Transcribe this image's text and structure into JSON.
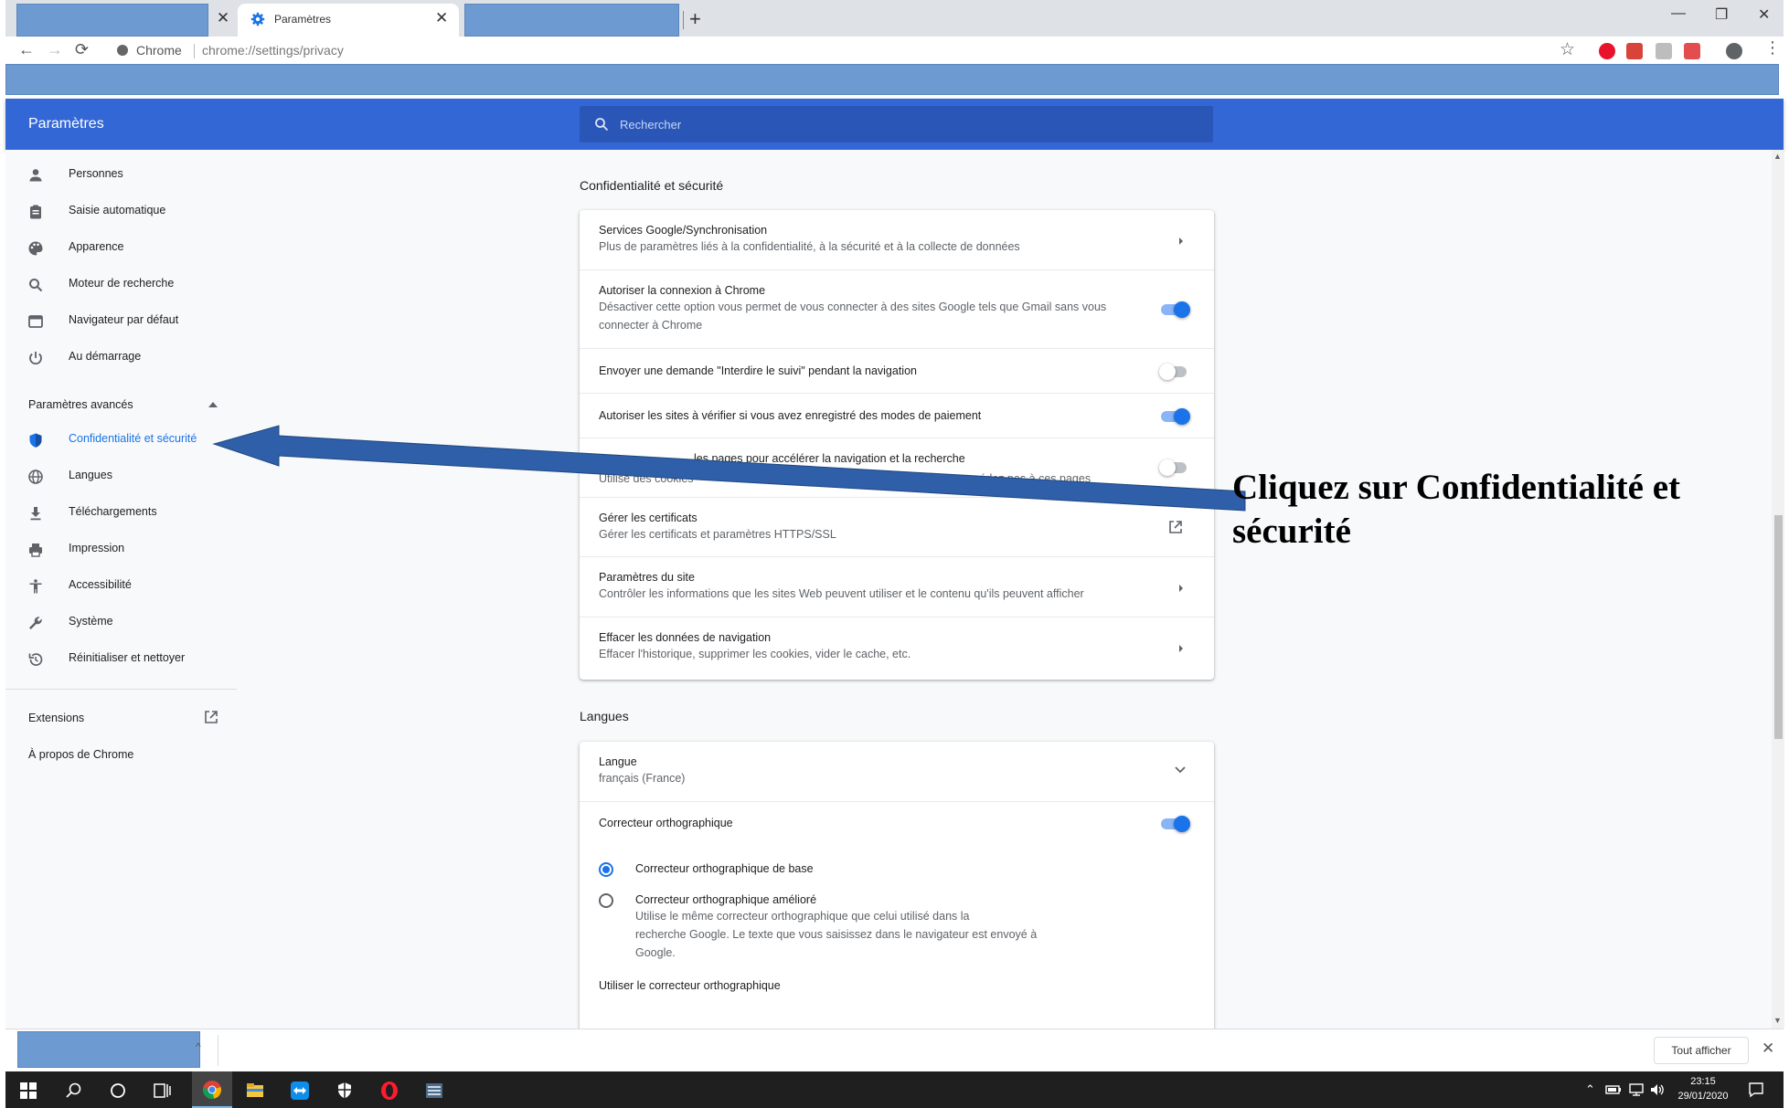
{
  "browser": {
    "active_tab_title": "Paramètres",
    "omnibox_site": "Chrome",
    "omnibox_url": "chrome://settings/privacy",
    "accent_color": "#3367d6"
  },
  "header": {
    "title": "Paramètres",
    "search_placeholder": "Rechercher"
  },
  "sidebar": {
    "items": [
      {
        "label": "Personnes",
        "icon": "person-icon"
      },
      {
        "label": "Saisie automatique",
        "icon": "clipboard-icon"
      },
      {
        "label": "Apparence",
        "icon": "palette-icon"
      },
      {
        "label": "Moteur de recherche",
        "icon": "search-icon"
      },
      {
        "label": "Navigateur par défaut",
        "icon": "browser-window-icon"
      },
      {
        "label": "Au démarrage",
        "icon": "power-icon"
      }
    ],
    "advanced_label": "Paramètres avancés",
    "advanced_items": [
      {
        "label": "Confidentialité et sécurité",
        "icon": "shield-icon",
        "active": true
      },
      {
        "label": "Langues",
        "icon": "globe-icon"
      },
      {
        "label": "Téléchargements",
        "icon": "download-icon"
      },
      {
        "label": "Impression",
        "icon": "printer-icon"
      },
      {
        "label": "Accessibilité",
        "icon": "accessibility-icon"
      },
      {
        "label": "Système",
        "icon": "wrench-icon"
      },
      {
        "label": "Réinitialiser et nettoyer",
        "icon": "restore-icon"
      }
    ],
    "extensions_label": "Extensions",
    "about_label": "À propos de Chrome"
  },
  "privacy": {
    "section_title": "Confidentialité et sécurité",
    "rows": [
      {
        "title": "Services Google/Synchronisation",
        "subtitle": "Plus de paramètres liés à la confidentialité, à la sécurité et à la collecte de données",
        "control": "chevron"
      },
      {
        "title": "Autoriser la connexion à Chrome",
        "subtitle_line1": "Désactiver cette option vous permet de vous connecter à des sites Google tels que Gmail sans vous",
        "subtitle_line2": "connecter à Chrome",
        "control": "toggle",
        "on": true
      },
      {
        "title": "Envoyer une demande \"Interdire le suivi\" pendant la navigation",
        "control": "toggle",
        "on": false
      },
      {
        "title": "Autoriser les sites à vérifier si vous avez enregistré des modes de paiement",
        "control": "toggle",
        "on": true
      },
      {
        "title_visible_part": "les pages pour accélérer la navigation et la recherche",
        "subtitle_visible_part": "Utilise des cookies",
        "subtitle_visible_tail": "accédez pas à ces pages",
        "control": "toggle",
        "on": false
      },
      {
        "title": "Gérer les certificats",
        "subtitle": "Gérer les certificats et paramètres HTTPS/SSL",
        "control": "external"
      },
      {
        "title": "Paramètres du site",
        "subtitle": "Contrôler les informations que les sites Web peuvent utiliser et le contenu qu'ils peuvent afficher",
        "control": "chevron"
      },
      {
        "title": "Effacer les données de navigation",
        "subtitle": "Effacer l'historique, supprimer les cookies, vider le cache, etc.",
        "control": "chevron"
      }
    ]
  },
  "languages": {
    "section_title": "Langues",
    "language_label": "Langue",
    "language_value": "français (France)",
    "spellcheck_label": "Correcteur orthographique",
    "spellcheck_on": true,
    "radio_basic": "Correcteur orthographique de base",
    "radio_enhanced": "Correcteur orthographique amélioré",
    "enhanced_desc_line1": "Utilise le même correcteur orthographique que celui utilisé dans la",
    "enhanced_desc_line2": "recherche Google. Le texte que vous saisissez dans le navigateur est envoyé à",
    "enhanced_desc_line3": "Google.",
    "use_spellcheck_label": "Utiliser le correcteur orthographique"
  },
  "annotation": {
    "text": "Cliquez sur Confidentialité et sécurité",
    "arrow_color": "#2e5fa8"
  },
  "download_bar": {
    "show_all_label": "Tout afficher"
  },
  "taskbar": {
    "time": "23:15",
    "date": "29/01/2020"
  }
}
